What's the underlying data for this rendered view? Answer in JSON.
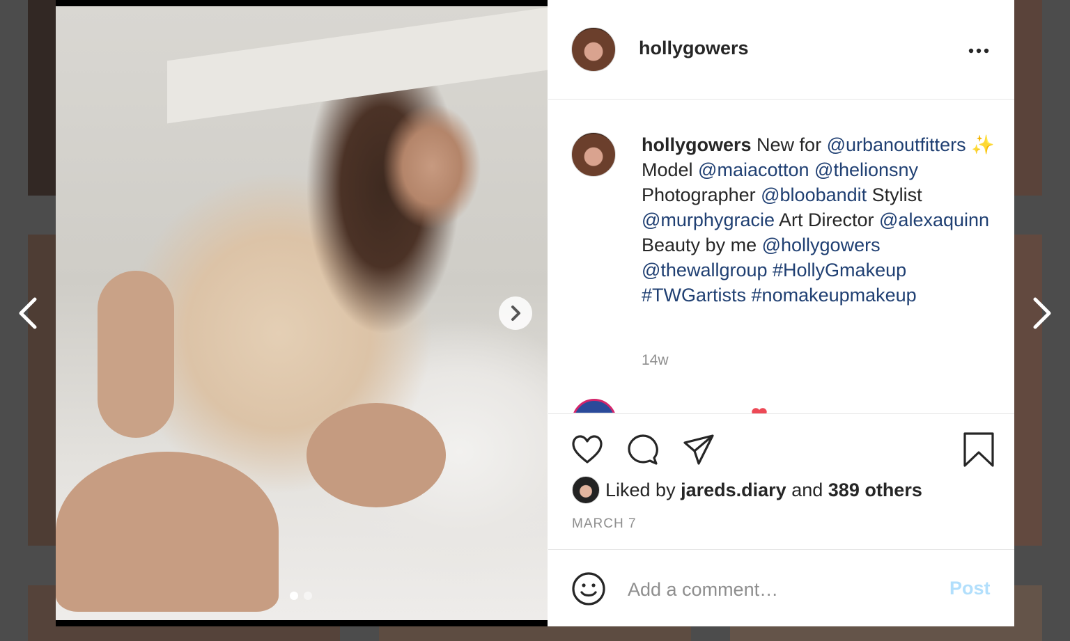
{
  "post": {
    "username": "hollygowers",
    "more_icon": "more-horizontal-icon",
    "caption": {
      "username": "hollygowers",
      "segments": [
        {
          "type": "text",
          "value": " New for "
        },
        {
          "type": "tag",
          "value": "@urbanoutfitters"
        },
        {
          "type": "text",
          "value": " ✨ Model "
        },
        {
          "type": "tag",
          "value": "@maiacotton"
        },
        {
          "type": "text",
          "value": " "
        },
        {
          "type": "tag",
          "value": "@thelionsny"
        },
        {
          "type": "text",
          "value": " Photographer "
        },
        {
          "type": "tag",
          "value": "@bloobandit"
        },
        {
          "type": "text",
          "value": " Stylist "
        },
        {
          "type": "tag",
          "value": "@murphygracie"
        },
        {
          "type": "text",
          "value": " Art Director "
        },
        {
          "type": "tag",
          "value": "@alexaquinn"
        },
        {
          "type": "text",
          "value": " Beauty by me "
        },
        {
          "type": "tag",
          "value": "@hollygowers"
        },
        {
          "type": "text",
          "value": " "
        },
        {
          "type": "tag",
          "value": "@thewallgroup"
        },
        {
          "type": "text",
          "value": " "
        },
        {
          "type": "tag",
          "value": "#HollyGmakeup"
        },
        {
          "type": "text",
          "value": " "
        },
        {
          "type": "tag",
          "value": "#TWGartists"
        },
        {
          "type": "text",
          "value": " "
        },
        {
          "type": "tag",
          "value": "#nomakeupmakeup"
        }
      ],
      "age": "14w"
    },
    "likes": {
      "prefix": "Liked by",
      "first_liker": "jareds.diary",
      "joiner": "and",
      "others": "389 others"
    },
    "date": "MARCH 7",
    "comment": {
      "placeholder": "Add a comment…",
      "post_label": "Post"
    },
    "carousel": {
      "slide_count": 2,
      "active_index": 0
    }
  },
  "icons": {
    "like": "heart-icon",
    "comment": "comment-icon",
    "share": "send-icon",
    "save": "bookmark-icon",
    "emoji": "emoji-icon",
    "prev": "chevron-left-icon",
    "next": "chevron-right-icon"
  },
  "colors": {
    "link": "#1f3f72",
    "text": "#262626",
    "muted": "#8e8e8e",
    "post_disabled": "#b2dffc"
  }
}
